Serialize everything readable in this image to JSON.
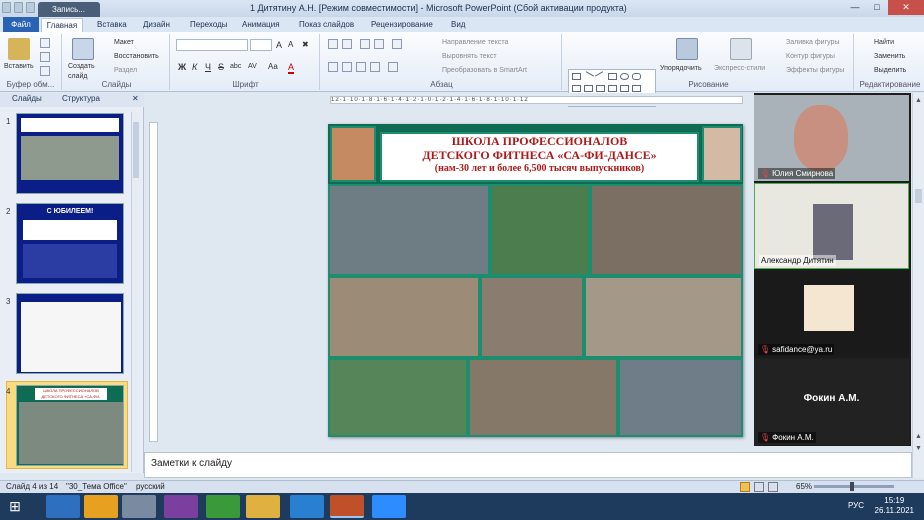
{
  "window": {
    "title": "1 Дитятину А.Н. [Режим совместимости] - Microsoft PowerPoint (Сбой активации продукта)",
    "recording_tab": "Запись..."
  },
  "ribbon_tabs": [
    "Файл",
    "Главная",
    "Вставка",
    "Дизайн",
    "Переходы",
    "Анимация",
    "Показ слайдов",
    "Рецензирование",
    "Вид"
  ],
  "ribbon": {
    "clipboard": {
      "paste": "Вставить",
      "label": "Буфер обм..."
    },
    "slides": {
      "create": "Создать слайд",
      "layout": "Макет",
      "restore": "Восстановить",
      "section": "Раздел",
      "label": "Слайды"
    },
    "font": {
      "label": "Шрифт",
      "size": "",
      "bold": "Ж",
      "italic": "К",
      "underline": "Ч",
      "strike": "S",
      "abc": "abc",
      "spacing": "AV",
      "case": "Aa",
      "color": "A"
    },
    "paragraph": {
      "text_direction": "Направление текста",
      "align_text": "Выровнять текст",
      "smartart": "Преобразовать в SmartArt",
      "label": "Абзац"
    },
    "drawing": {
      "arrange": "Упорядочить",
      "quick_styles": "Экспресс-стили",
      "fill": "Заливка фигуры",
      "outline": "Контур фигуры",
      "effects": "Эффекты фигуры",
      "label": "Рисование"
    },
    "editing": {
      "find": "Найти",
      "replace": "Заменить",
      "select": "Выделить",
      "label": "Редактирование"
    }
  },
  "panel_tabs": [
    "Слайды",
    "Структура"
  ],
  "slide_numbers": [
    "1",
    "2",
    "3",
    "4"
  ],
  "thumbs": {
    "t2_title": "С ЮБИЛЕЕМ!",
    "t4_title": "ШКОЛА ПРОФЕССИОНАЛОВ ДЕТСКОГО ФИТНЕСА «СА-ФИ-ДАНСЕ»"
  },
  "slide": {
    "title_line1": "ШКОЛА ПРОФЕССИОНАЛОВ",
    "title_line2": "ДЕТСКОГО ФИТНЕСА «СА-ФИ-ДАНСЕ»",
    "title_line3": "(нам-30 лет и более 6,500 тысяч выпускников)"
  },
  "ruler_text": "12·1·10·1·8·1·6·1·4·1·2·1·0·1·2·1·4·1·6·1·8·1·10·1·12",
  "notes_placeholder": "Заметки к слайду",
  "status": {
    "slide_of": "Слайд 4 из 14",
    "theme": "\"30_Тема Office\"",
    "language": "русский",
    "zoom": "65%"
  },
  "participants": [
    {
      "name": "Юлия Смирнова"
    },
    {
      "name": "Александр Дитятин"
    },
    {
      "name": "safidance@ya.ru"
    },
    {
      "name": "Фокин А.М."
    }
  ],
  "participant_center_name": "Фокин А.М.",
  "taskbar": {
    "lang": "РУС",
    "time": "15:19",
    "date": "26.11.2021"
  },
  "colors": {
    "accent": "#2a63b3",
    "slide_green": "#0f6c54",
    "title_red": "#b21818"
  }
}
